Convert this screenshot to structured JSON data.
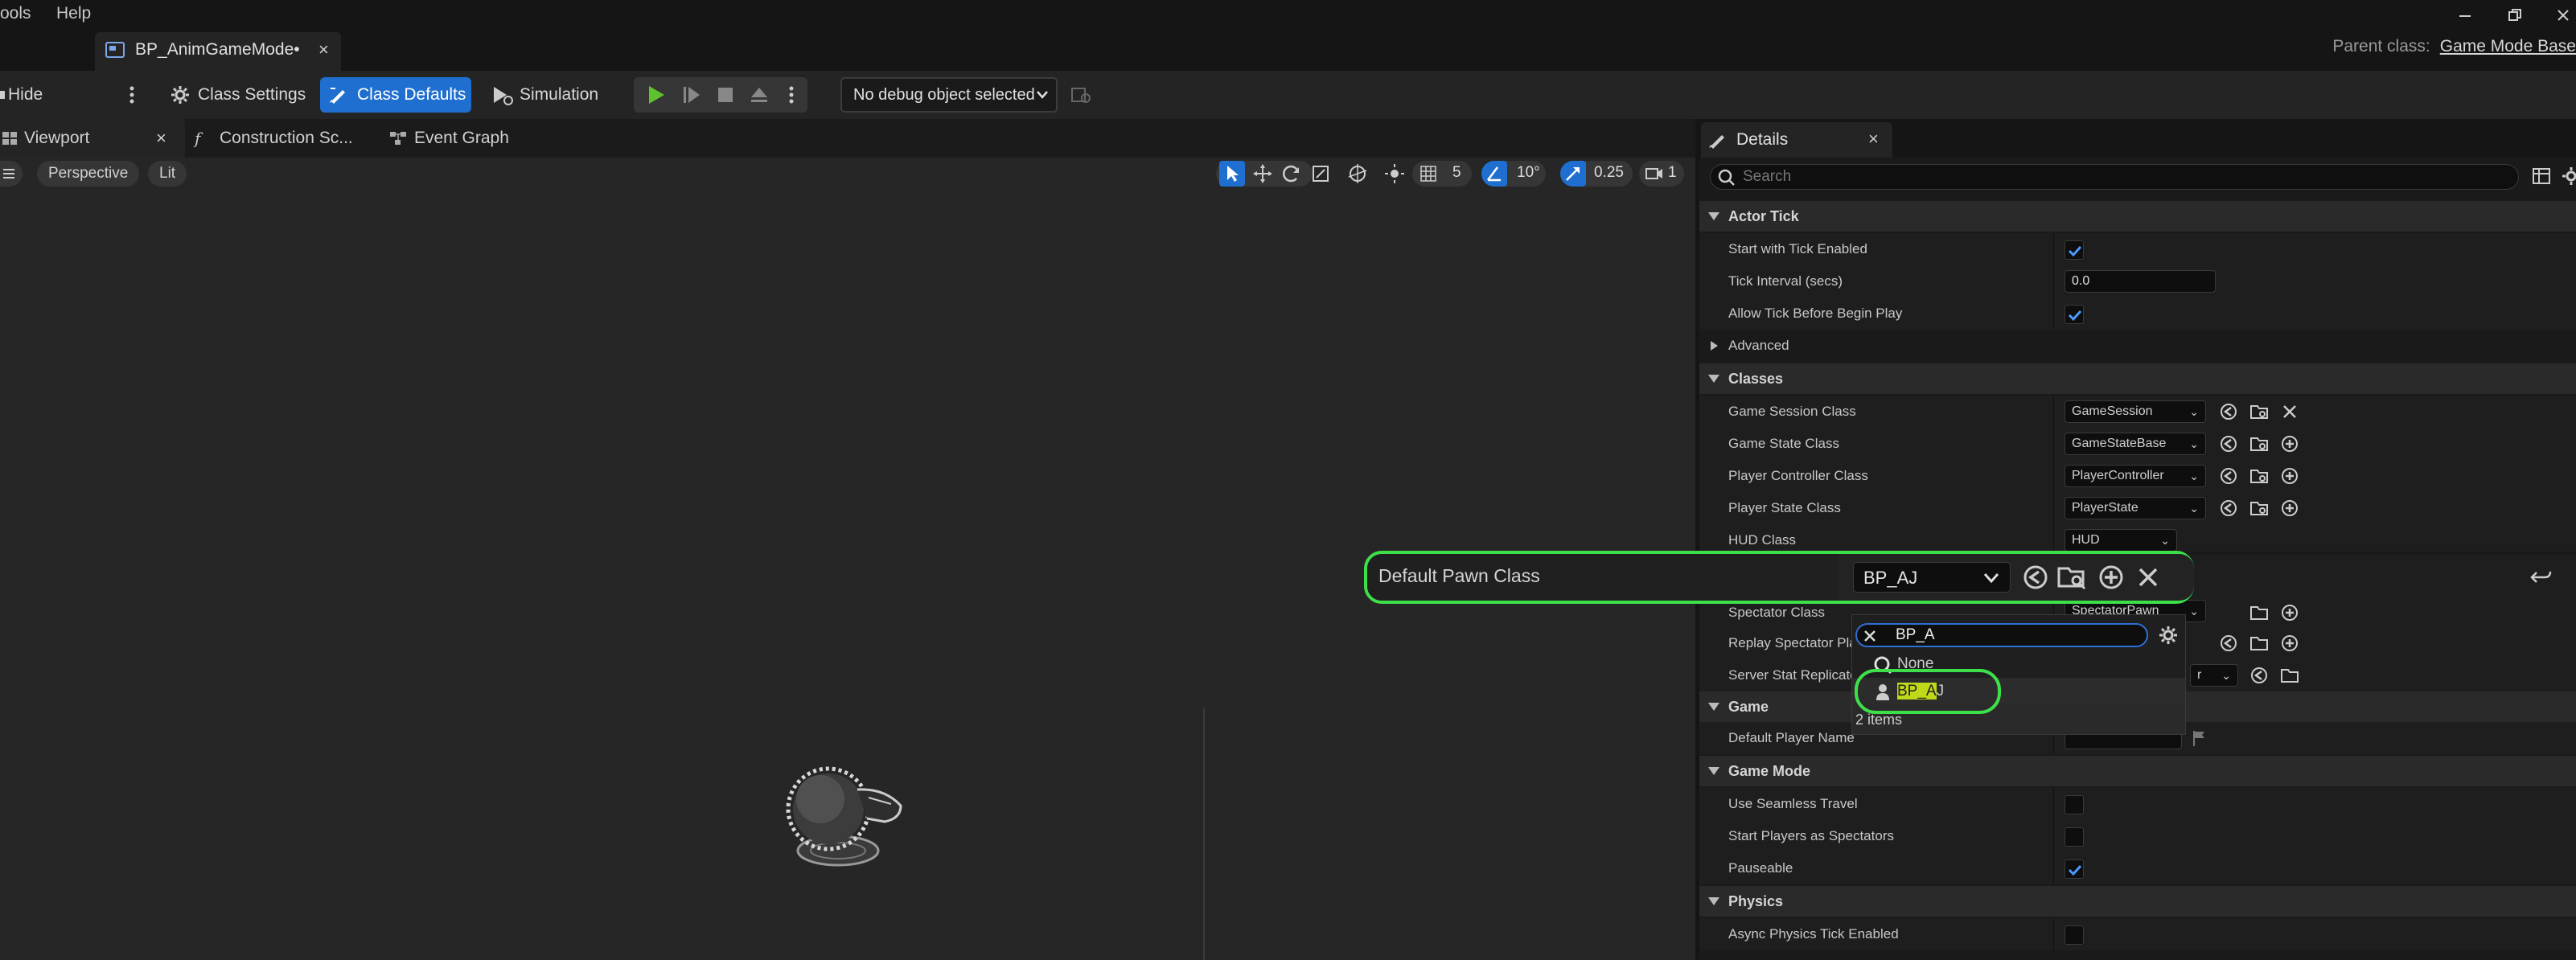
{
  "menu": {
    "tools": "ools",
    "help": "Help"
  },
  "document_tab": {
    "title": "BP_AnimGameMode•",
    "close": "×"
  },
  "parent_class": {
    "label": "Parent class:",
    "value": "Game Mode Base"
  },
  "toolbar": {
    "hide_unrelated": "Hide Unrelated",
    "class_settings": "Class Settings",
    "class_defaults": "Class Defaults",
    "simulation": "Simulation",
    "debug_object": "No debug object selected"
  },
  "panel_tabs": {
    "viewport": "Viewport",
    "construction": "Construction Sc...",
    "event_graph": "Event Graph",
    "close": "×"
  },
  "viewport": {
    "perspective": "Perspective",
    "lit": "Lit",
    "grid_snap": "5",
    "rotation_snap": "10°",
    "scale_snap": "0.25",
    "camera_speed": "1"
  },
  "details": {
    "tab_title": "Details",
    "close": "×",
    "search_placeholder": "Search",
    "actor_tick": {
      "header": "Actor Tick",
      "start_with_tick": "Start with Tick Enabled",
      "tick_interval": "Tick Interval (secs)",
      "tick_interval_value": "0.0",
      "allow_tick": "Allow Tick Before Begin Play",
      "advanced": "Advanced"
    },
    "classes": {
      "header": "Classes",
      "rows": [
        {
          "label": "Game Session Class",
          "value": "GameSession"
        },
        {
          "label": "Game State Class",
          "value": "GameStateBase"
        },
        {
          "label": "Player Controller Class",
          "value": "PlayerController"
        },
        {
          "label": "Player State Class",
          "value": "PlayerState"
        },
        {
          "label": "HUD Class",
          "value": "HUD"
        },
        {
          "label": "Spectator Class",
          "value": "SpectatorPawn"
        },
        {
          "label": "Replay Spectator Pla",
          "value": ""
        },
        {
          "label": "Server Stat Replicato",
          "value": "r"
        }
      ]
    },
    "game": {
      "header": "Game",
      "default_player_name": "Default Player Name"
    },
    "game_mode": {
      "header": "Game Mode",
      "seamless": "Use Seamless Travel",
      "spectators": "Start Players as Spectators",
      "pauseable": "Pauseable"
    },
    "physics": {
      "header": "Physics",
      "async": "Async Physics Tick Enabled"
    }
  },
  "popup": {
    "label": "Default Pawn Class",
    "selected": "BP_AJ"
  },
  "dropdown": {
    "search_value": "BP_A",
    "items": [
      {
        "label": "None"
      },
      {
        "label_highlight": "BP_A",
        "label_rest": "J"
      }
    ],
    "count": "2 items"
  },
  "colors": {
    "accent_blue": "#1f6fd0",
    "highlight_green": "#3ee04a",
    "play_green": "#5fc12e"
  }
}
